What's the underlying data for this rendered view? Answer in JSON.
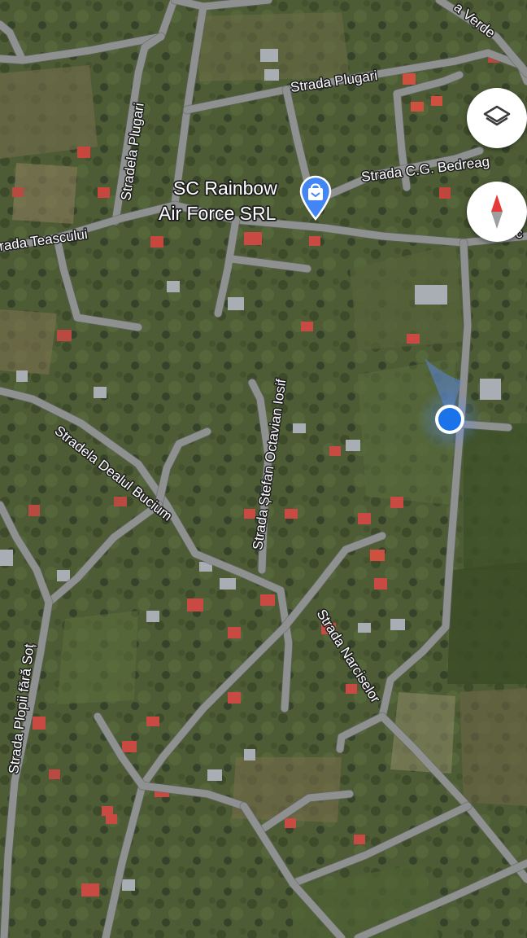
{
  "map": {
    "type": "satellite",
    "poi": {
      "name_line1": "SC Rainbow",
      "name_line2": "Air Force SRL",
      "icon": "shopping-bag-pin-icon",
      "pin_color": "#4285f4"
    },
    "streets": {
      "plugari": "Strada Plugari",
      "stradela_plugari": "Stradela Plugari",
      "bedreag": "Strada C.G. Bedreag",
      "teascului": "rada Teascului",
      "verde": "a Verde",
      "dealul_bucium": "Stradela Dealul Bucium",
      "stefan_iosif": "Strada Ștefan Octavian Iosif",
      "narciselor": "Strada Narciselor",
      "plopii": "Strada Plopii fără Soț"
    },
    "edge_fragment": "c",
    "location_dot_color": "#1a73e8"
  },
  "controls": {
    "layers_icon": "layers-icon",
    "compass_icon": "compass-icon",
    "compass_colors": {
      "north": "#e53935",
      "south": "#9e9e9e"
    }
  }
}
